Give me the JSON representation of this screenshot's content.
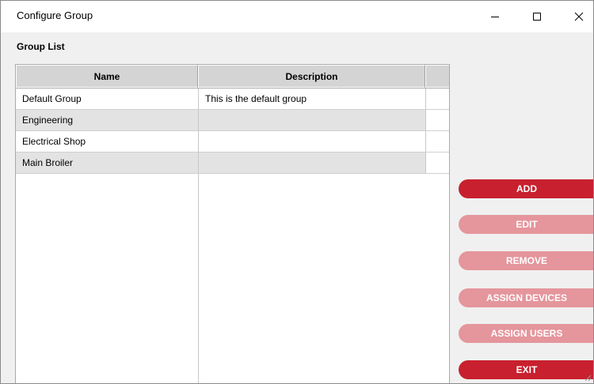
{
  "window": {
    "title": "Configure Group"
  },
  "group_list": {
    "label": "Group List",
    "columns": [
      "Name",
      "Description"
    ],
    "rows": [
      {
        "name": "Default Group",
        "description": "This is the default group"
      },
      {
        "name": "Engineering",
        "description": ""
      },
      {
        "name": "Electrical Shop",
        "description": ""
      },
      {
        "name": "Main Broiler",
        "description": ""
      }
    ]
  },
  "buttons": {
    "add": "ADD",
    "edit": "EDIT",
    "remove": "REMOVE",
    "assign_devices": "ASSIGN DEVICES",
    "assign_users": "ASSIGN USERS",
    "exit": "EXIT"
  },
  "colors": {
    "button_active": "#c8202e",
    "button_disabled": "#e5959c",
    "header_bg": "#d4d4d4",
    "alt_row_bg": "#e3e3e3"
  }
}
